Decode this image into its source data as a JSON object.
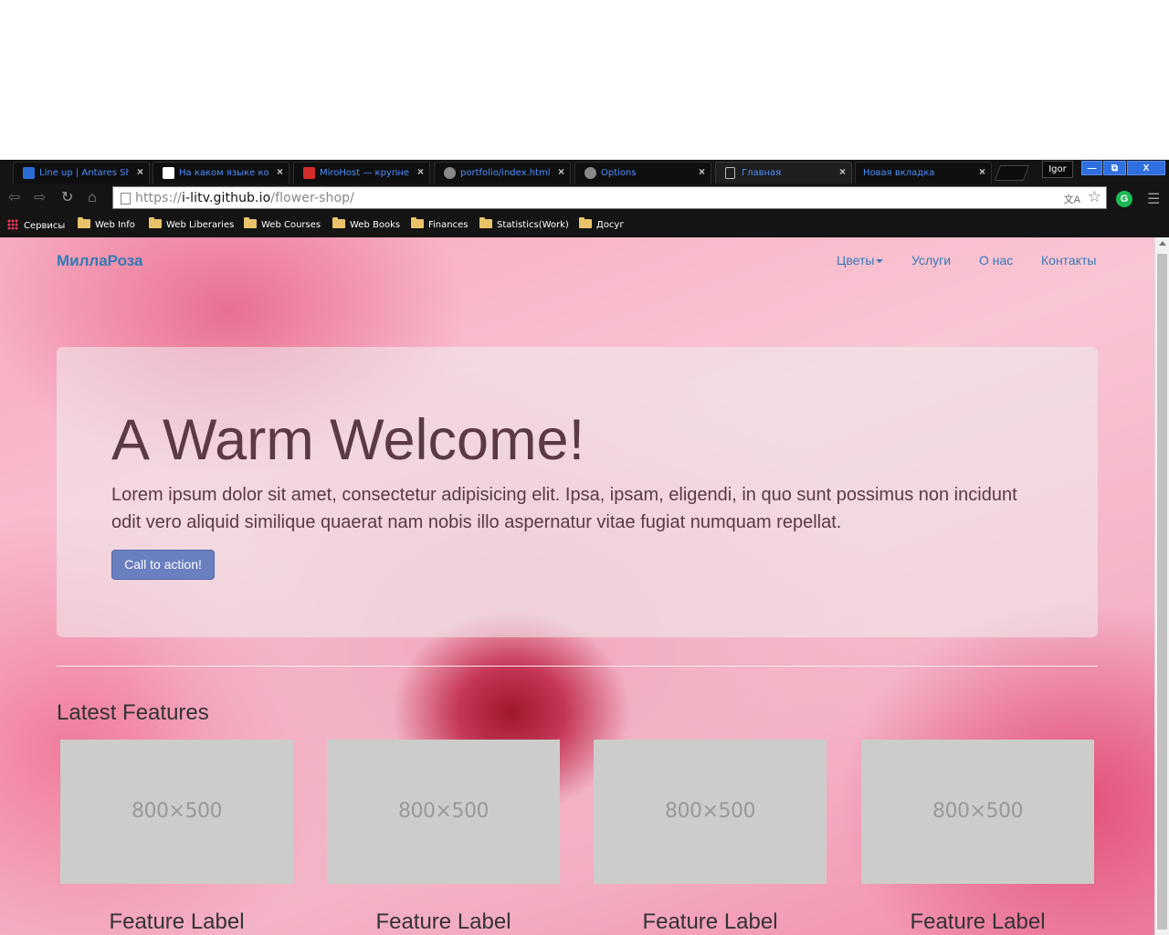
{
  "browser": {
    "tabs": [
      {
        "title": "Line up | Antares Sh",
        "active": false,
        "favicon_color": "#2b6cd6"
      },
      {
        "title": "На каком языке ко",
        "active": false,
        "favicon_color": "#ffffff"
      },
      {
        "title": "MiroHost — крупней",
        "active": false,
        "favicon_color": "#d42b2b"
      },
      {
        "title": "portfolio/index.html",
        "active": false,
        "favicon_color": "#888888"
      },
      {
        "title": "Options",
        "active": false,
        "favicon_color": "#888888"
      },
      {
        "title": "Главная",
        "active": true,
        "favicon_color": "#bbbbbb"
      },
      {
        "title": "Новая вкладка",
        "active": false,
        "favicon_color": "#000000"
      }
    ],
    "profile_name": "Igor",
    "window_controls": {
      "minimize": "—",
      "restore": "⧉",
      "close": "X"
    },
    "url_scheme": "https://",
    "url_host": "i-litv.github.io",
    "url_path": "/flower-shop/",
    "bookmarks": [
      {
        "label": "Сервисы",
        "icon": "apps-icon"
      },
      {
        "label": "Web Info",
        "icon": "folder-icon"
      },
      {
        "label": "Web Liberaries",
        "icon": "folder-icon"
      },
      {
        "label": "Web Courses",
        "icon": "folder-icon"
      },
      {
        "label": "Web Books",
        "icon": "folder-icon"
      },
      {
        "label": "Finances",
        "icon": "folder-icon"
      },
      {
        "label": "Statistics(Work)",
        "icon": "folder-icon"
      },
      {
        "label": "Досуг",
        "icon": "folder-icon"
      }
    ]
  },
  "site": {
    "brand": "МиллаРоза",
    "nav": [
      {
        "label": "Цветы",
        "dropdown": true
      },
      {
        "label": "Услуги",
        "dropdown": false
      },
      {
        "label": "О нас",
        "dropdown": false
      },
      {
        "label": "Контакты",
        "dropdown": false
      }
    ],
    "hero": {
      "title": "A Warm Welcome!",
      "text": "Lorem ipsum dolor sit amet, consectetur adipisicing elit. Ipsa, ipsam, eligendi, in quo sunt possimus non incidunt odit vero aliquid similique quaerat nam nobis illo aspernatur vitae fugiat numquam repellat.",
      "cta_label": "Call to action!"
    },
    "features_heading": "Latest Features",
    "features": [
      {
        "placeholder": "800×500",
        "label": "Feature Label"
      },
      {
        "placeholder": "800×500",
        "label": "Feature Label"
      },
      {
        "placeholder": "800×500",
        "label": "Feature Label"
      },
      {
        "placeholder": "800×500",
        "label": "Feature Label"
      }
    ]
  },
  "colors": {
    "link": "#337ab7",
    "cta": "#6a7fbf",
    "tab_text": "#4d8fff"
  }
}
